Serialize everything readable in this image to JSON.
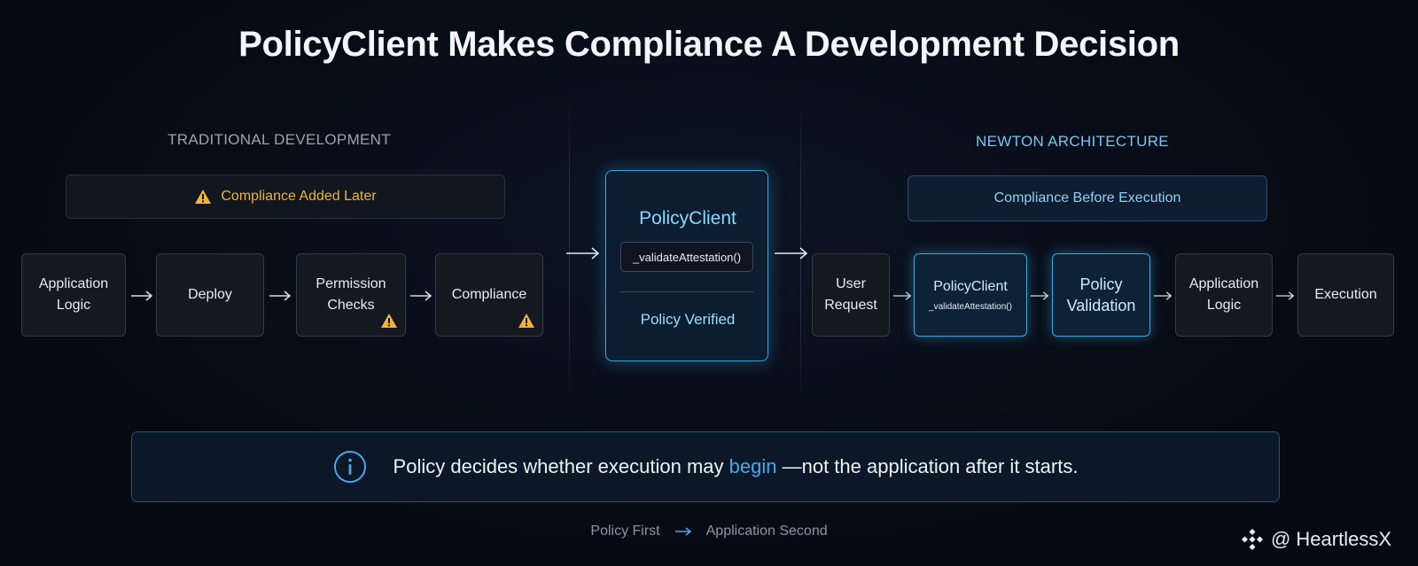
{
  "title": "PolicyClient Makes Compliance A Development Decision",
  "traditional": {
    "label": "TRADITIONAL DEVELOPMENT",
    "banner": "Compliance Added Later",
    "steps": [
      {
        "line1": "Application",
        "line2": "Logic"
      },
      {
        "line1": "Deploy",
        "line2": ""
      },
      {
        "line1": "Permission",
        "line2": "Checks"
      },
      {
        "line1": "Compliance",
        "line2": ""
      }
    ]
  },
  "center": {
    "title": "PolicyClient",
    "code": "_validateAttestation()",
    "status": "Policy Verified"
  },
  "newton": {
    "label": "NEWTON ARCHITECTURE",
    "banner": "Compliance Before Execution",
    "steps": [
      {
        "line1": "User",
        "line2": "Request"
      },
      {
        "line1": "PolicyClient",
        "sub": "_validateAttestation()"
      },
      {
        "line1": "Policy",
        "line2": "Validation"
      },
      {
        "line1": "Application",
        "line2": "Logic"
      },
      {
        "line1": "Execution",
        "line2": ""
      }
    ]
  },
  "info": {
    "before": "Policy decides whether execution may",
    "highlight": "begin",
    "after": "—not the application after it starts."
  },
  "footer": {
    "left": "Policy First",
    "right": "Application Second"
  },
  "watermark": "@ HeartlessX",
  "colors": {
    "accent": "#3ea9e0",
    "warning": "#f0b43c",
    "highlight": "#4aa8ec"
  }
}
